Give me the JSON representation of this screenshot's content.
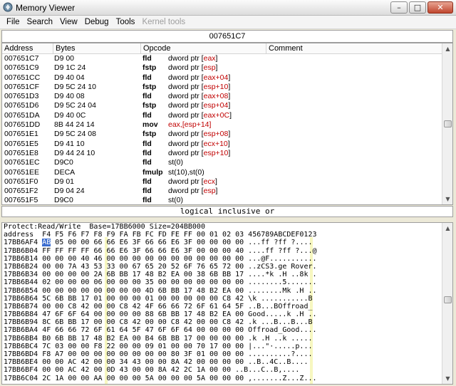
{
  "window": {
    "title": "Memory Viewer",
    "buttons": {
      "min": "–",
      "max": "□",
      "close": "✕"
    }
  },
  "menu": [
    "File",
    "Search",
    "View",
    "Debug",
    "Tools",
    "Kernel tools"
  ],
  "address_box": "007651C7",
  "disassembler": {
    "headers": [
      "Address",
      "Bytes",
      "Opcode",
      "Comment"
    ],
    "rows": [
      {
        "addr": "007651C7",
        "bytes": "D9 00",
        "op": "fld",
        "pre": "dword ptr [",
        "reg": "eax",
        "post": "]"
      },
      {
        "addr": "007651C9",
        "bytes": "D9 1C 24",
        "op": "fstp",
        "pre": "dword ptr [",
        "reg": "esp",
        "post": "]"
      },
      {
        "addr": "007651CC",
        "bytes": "D9 40 04",
        "op": "fld",
        "pre": "dword ptr [",
        "reg": "eax+04",
        "post": "]"
      },
      {
        "addr": "007651CF",
        "bytes": "D9 5C 24 10",
        "op": "fstp",
        "pre": "dword ptr [",
        "reg": "esp+10",
        "post": "]"
      },
      {
        "addr": "007651D3",
        "bytes": "D9 40 08",
        "op": "fld",
        "pre": "dword ptr [",
        "reg": "eax+08",
        "post": "]"
      },
      {
        "addr": "007651D6",
        "bytes": "D9 5C 24 04",
        "op": "fstp",
        "pre": "dword ptr [",
        "reg": "esp+04",
        "post": "]"
      },
      {
        "addr": "007651DA",
        "bytes": "D9 40 0C",
        "op": "fld",
        "pre": "dword ptr [",
        "reg": "eax+0C",
        "post": "]"
      },
      {
        "addr": "007651DD",
        "bytes": "8B 44 24 14",
        "op": "mov",
        "pre": "",
        "reg": "eax,[esp+14]",
        "post": ""
      },
      {
        "addr": "007651E1",
        "bytes": "D9 5C 24 08",
        "op": "fstp",
        "pre": "dword ptr [",
        "reg": "esp+08",
        "post": "]"
      },
      {
        "addr": "007651E5",
        "bytes": "D9 41 10",
        "op": "fld",
        "pre": "dword ptr [",
        "reg": "ecx+10",
        "post": "]"
      },
      {
        "addr": "007651E8",
        "bytes": "D9 44 24 10",
        "op": "fld",
        "pre": "dword ptr [",
        "reg": "esp+10",
        "post": "]"
      },
      {
        "addr": "007651EC",
        "bytes": "D9C0",
        "op": "fld",
        "pre": "st(0)",
        "reg": "",
        "post": ""
      },
      {
        "addr": "007651EE",
        "bytes": "DECA",
        "op": "fmulp",
        "pre": "st(10),st(0)",
        "reg": "",
        "post": ""
      },
      {
        "addr": "007651F0",
        "bytes": "D9 01",
        "op": "fld",
        "pre": "dword ptr [",
        "reg": "ecx",
        "post": "]"
      },
      {
        "addr": "007651F2",
        "bytes": "D9 04 24",
        "op": "fld",
        "pre": "dword ptr [",
        "reg": "esp",
        "post": "]"
      },
      {
        "addr": "007651F5",
        "bytes": "D9C0",
        "op": "fld",
        "pre": "st(0)",
        "reg": "",
        "post": ""
      }
    ]
  },
  "info_bar": "logical inclusive or",
  "hex": {
    "protect_line": "Protect:Read/Write  Base=17BB6000 Size=204BB000",
    "column_header": "address  F4 F5 F6 F7 F8 F9 FA FB FC FD FE FF 00 01 02 03 456789ABCDEF0123",
    "selected_byte": "AB",
    "rows": [
      {
        "addr": "17BB6AF4",
        "pre": " ",
        "hex": " 05 00 00 66 66 E6 3F 66 66 E6 3F 00 00 00 00",
        "ascii": " ...ff ?ff ?...."
      },
      {
        "addr": "17BB6B04",
        "pre": " FF FF FF FF 66 66 E6 3F 66 66 E6 3F 00 00 00 40",
        "hex": "",
        "ascii": " ....ff ?ff ?...@"
      },
      {
        "addr": "17BB6B14",
        "pre": " 00 00 00 40 46 00 00 00 00 00 00 00 00 00 00 00",
        "hex": "",
        "ascii": " ...@F..........."
      },
      {
        "addr": "17BB6B24",
        "pre": " 00 00 7A 43 53 33 00 67 65 20 52 6F 76 65 72 00",
        "hex": "",
        "ascii": " ..zCS3.ge Rover."
      },
      {
        "addr": "17BB6B34",
        "pre": " 00 00 00 00 2A 6B BB 17 48 B2 EA 00 38 6B BB 17",
        "hex": "",
        "ascii": " ....*k .H ..8k ."
      },
      {
        "addr": "17BB6B44",
        "pre": " 02 00 00 00 06 00 00 00 35 00 00 00 00 00 00 00",
        "hex": "",
        "ascii": " ........5......."
      },
      {
        "addr": "17BB6B54",
        "pre": " 00 00 00 00 00 00 00 00 4D 6B BB 17 48 B2 EA 00",
        "hex": "",
        "ascii": " ........Mk .H .."
      },
      {
        "addr": "17BB6B64",
        "pre": " 5C 6B BB 17 01 00 00 00 01 00 00 00 00 00 C8 42",
        "hex": "",
        "ascii": " \\k ...........B"
      },
      {
        "addr": "17BB6B74",
        "pre": " 00 00 C8 42 00 00 C8 42 4F 66 66 72 6F 61 64 5F",
        "hex": "",
        "ascii": " ..B...BOffroad_"
      },
      {
        "addr": "17BB6B84",
        "pre": " 47 6F 6F 64 00 00 00 00 88 6B BB 17 48 B2 EA 00",
        "hex": "",
        "ascii": " Good.....k .H .."
      },
      {
        "addr": "17BB6B94",
        "pre": " 8C 6B BB 17 00 00 C8 42 00 00 C8 42 00 00 C8 42",
        "hex": "",
        "ascii": " .k ...B...B...B"
      },
      {
        "addr": "17BB6BA4",
        "pre": " 4F 66 66 72 6F 61 64 5F 47 6F 6F 64 00 00 00 00",
        "hex": "",
        "ascii": " Offroad_Good...."
      },
      {
        "addr": "17BB6BB4",
        "pre": " B0 6B BB 17 48 B2 EA 00 B4 6B BB 17 00 00 00 00",
        "hex": "",
        "ascii": " .k .H ..k ....."
      },
      {
        "addr": "17BB6BC4",
        "pre": " 7C 03 00 00 F8 22 00 00 09 01 00 00 70 17 00 00",
        "hex": "",
        "ascii": " |...\"·.....p..."
      },
      {
        "addr": "17BB6BD4",
        "pre": " F8 A7 00 00 00 00 00 00 00 00 80 3F 01 00 00 00",
        "hex": "",
        "ascii": " ..........?...."
      },
      {
        "addr": "17BB6BE4",
        "pre": " 00 00 AC 42 00 00 34 43 00 00 8A 42 00 00 00 00",
        "hex": "",
        "ascii": " ..B..4C..B...."
      },
      {
        "addr": "17BB6BF4",
        "pre": " 00 00 AC 42 00 0D 43 00 00 8A 42 2C 1A 00 00",
        "hex": "",
        "ascii": " ..B...C..B,...."
      },
      {
        "addr": "17BB6C04",
        "pre": " 2C 1A 00 00 AA 00 00 00 5A 00 00 00 5A 00 00 00",
        "hex": "",
        "ascii": " ,.......Z...Z..."
      }
    ]
  }
}
